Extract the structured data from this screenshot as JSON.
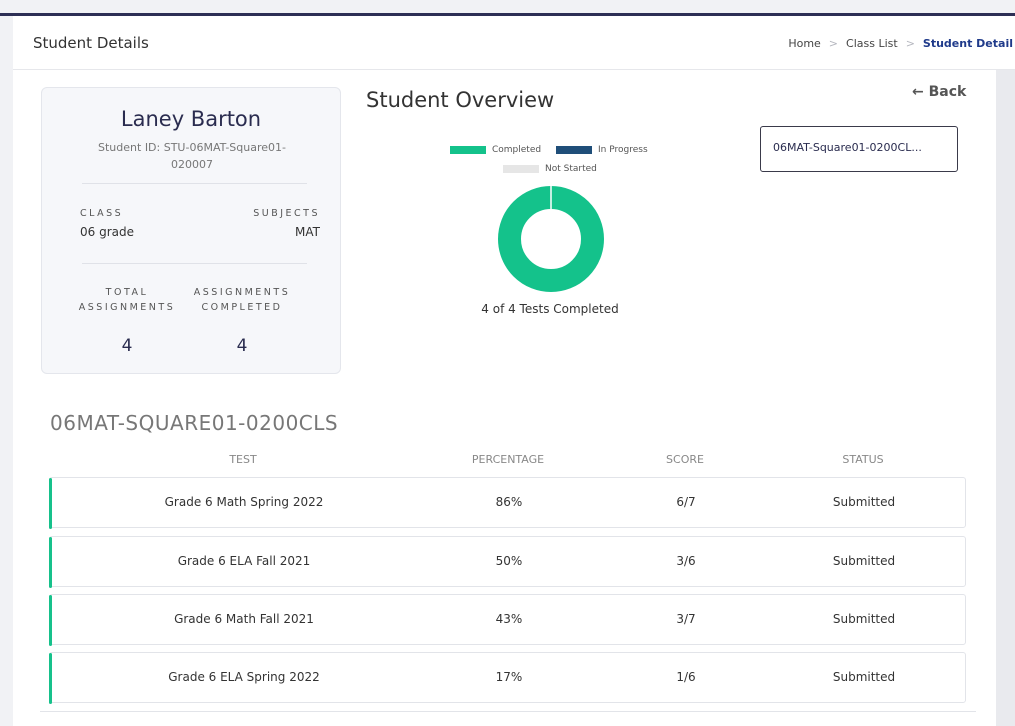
{
  "header": {
    "title": "Student Details",
    "breadcrumb": [
      "Home",
      "Class List",
      "Student Detail"
    ],
    "separator": ">"
  },
  "student": {
    "name": "Laney Barton",
    "id_text": "Student ID: STU-06MAT-Square01-020007",
    "class_label": "CLASS",
    "class_value": "06 grade",
    "subjects_label": "SUBJECTS",
    "subjects_value": "MAT",
    "total_label": "TOTAL ASSIGNMENTS",
    "total_value": "4",
    "completed_label": "ASSIGNMENTS COMPLETED",
    "completed_value": "4"
  },
  "overview": {
    "title": "Student Overview",
    "back_label": "← Back",
    "class_selector": "06MAT-Square01-0200CL...",
    "legend": [
      {
        "label": "Completed",
        "color": "#14c28b"
      },
      {
        "label": "In Progress",
        "color": "#1f4e79"
      },
      {
        "label": "Not Started",
        "color": "#e6e6e6"
      }
    ],
    "caption": "4 of 4 Tests Completed"
  },
  "chart_data": {
    "type": "pie",
    "categories": [
      "Completed",
      "In Progress",
      "Not Started"
    ],
    "values": [
      4,
      0,
      0
    ],
    "colors": [
      "#14c28b",
      "#1f4e79",
      "#e6e6e6"
    ],
    "legend_position": "top"
  },
  "tests": {
    "section_title": "06MAT-SQUARE01-0200CLS",
    "columns": [
      "TEST",
      "PERCENTAGE",
      "SCORE",
      "STATUS"
    ],
    "rows": [
      {
        "test": "Grade 6 Math Spring 2022",
        "percentage": "86%",
        "score": "6/7",
        "status": "Submitted"
      },
      {
        "test": "Grade 6 ELA Fall 2021",
        "percentage": "50%",
        "score": "3/6",
        "status": "Submitted"
      },
      {
        "test": "Grade 6 Math Fall 2021",
        "percentage": "43%",
        "score": "3/7",
        "status": "Submitted"
      },
      {
        "test": "Grade 6 ELA Spring 2022",
        "percentage": "17%",
        "score": "1/6",
        "status": "Submitted"
      }
    ]
  }
}
